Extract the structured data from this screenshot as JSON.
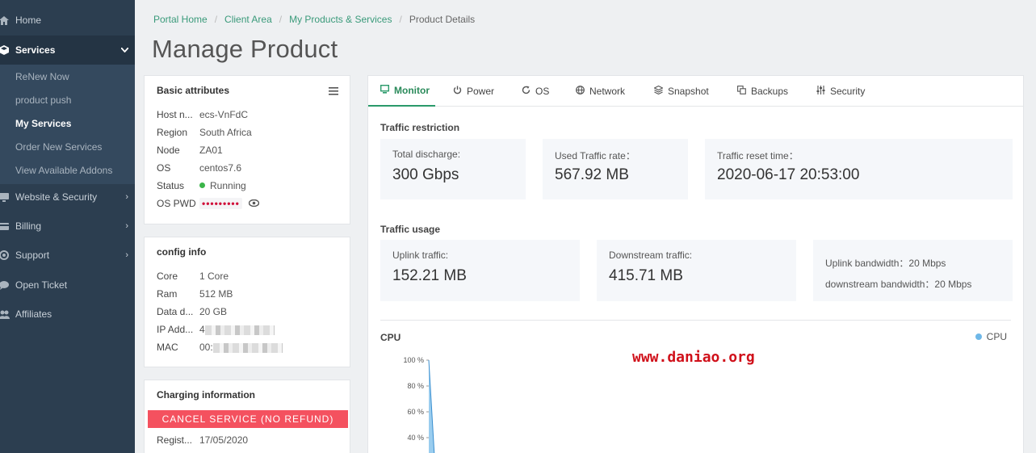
{
  "sidebar": {
    "items": [
      {
        "label": "Home",
        "icon": "home-icon"
      },
      {
        "label": "Services",
        "icon": "cube-icon"
      },
      {
        "label": "Website & Security",
        "icon": "monitor-icon"
      },
      {
        "label": "Billing",
        "icon": "credit-card-icon"
      },
      {
        "label": "Support",
        "icon": "life-ring-icon"
      },
      {
        "label": "Open Ticket",
        "icon": "comment-icon"
      },
      {
        "label": "Affiliates",
        "icon": "users-icon"
      }
    ],
    "services_sub": [
      "ReNew Now",
      "product push",
      "My Services",
      "Order New Services",
      "View Available Addons"
    ]
  },
  "breadcrumb": [
    "Portal Home",
    "Client Area",
    "My Products & Services",
    "Product Details"
  ],
  "page_title": "Manage Product",
  "basic": {
    "title": "Basic attributes",
    "rows": [
      {
        "k": "Host n...",
        "v": "ecs-VnFdC"
      },
      {
        "k": "Region",
        "v": "South Africa"
      },
      {
        "k": "Node",
        "v": "ZA01"
      },
      {
        "k": "OS",
        "v": "centos7.6"
      },
      {
        "k": "Status",
        "v": "Running"
      },
      {
        "k": "OS PWD",
        "v": "•••••••••"
      }
    ]
  },
  "config": {
    "title": "config info",
    "rows": [
      {
        "k": "Core",
        "v": "1 Core"
      },
      {
        "k": "Ram",
        "v": "512 MB"
      },
      {
        "k": "Data d...",
        "v": "20 GB"
      },
      {
        "k": "IP Add...",
        "v": "4"
      },
      {
        "k": "MAC",
        "v": "00:"
      }
    ]
  },
  "charging": {
    "title": "Charging information",
    "cancel_label": "CANCEL SERVICE (NO REFUND)",
    "rows": [
      {
        "k": "Regist...",
        "v": "17/05/2020"
      }
    ]
  },
  "tabs": [
    "Monitor",
    "Power",
    "OS",
    "Network",
    "Snapshot",
    "Backups",
    "Security"
  ],
  "traffic_restriction": {
    "title": "Traffic restriction",
    "total_label": "Total discharge:",
    "total_value": "300 Gbps",
    "used_label": "Used Traffic rate：",
    "used_value": "567.92 MB",
    "reset_label": "Traffic reset time：",
    "reset_value": "2020-06-17 20:53:00"
  },
  "traffic_usage": {
    "title": "Traffic usage",
    "uplink_label": "Uplink traffic:",
    "uplink_value": "152.21 MB",
    "downstream_label": "Downstream traffic:",
    "downstream_value": "415.71 MB",
    "uplink_bw": "Uplink bandwidth：20 Mbps",
    "downstream_bw": "downstream bandwidth：20 Mbps"
  },
  "cpu": {
    "title": "CPU",
    "legend": "CPU",
    "y_ticks": [
      "100 %",
      "80 %",
      "60 %",
      "40 %"
    ]
  },
  "chart_data": {
    "type": "area",
    "title": "CPU",
    "series": [
      {
        "name": "CPU",
        "values": [
          100,
          40
        ]
      }
    ],
    "ylim": [
      0,
      100
    ],
    "legend": "top-right"
  },
  "watermark": "www.daniao.org",
  "colors": {
    "accent": "#2a9a6a",
    "danger": "#f4515f",
    "sidebar": "#2c3e50",
    "cpu_series": "#6fb8e8"
  }
}
